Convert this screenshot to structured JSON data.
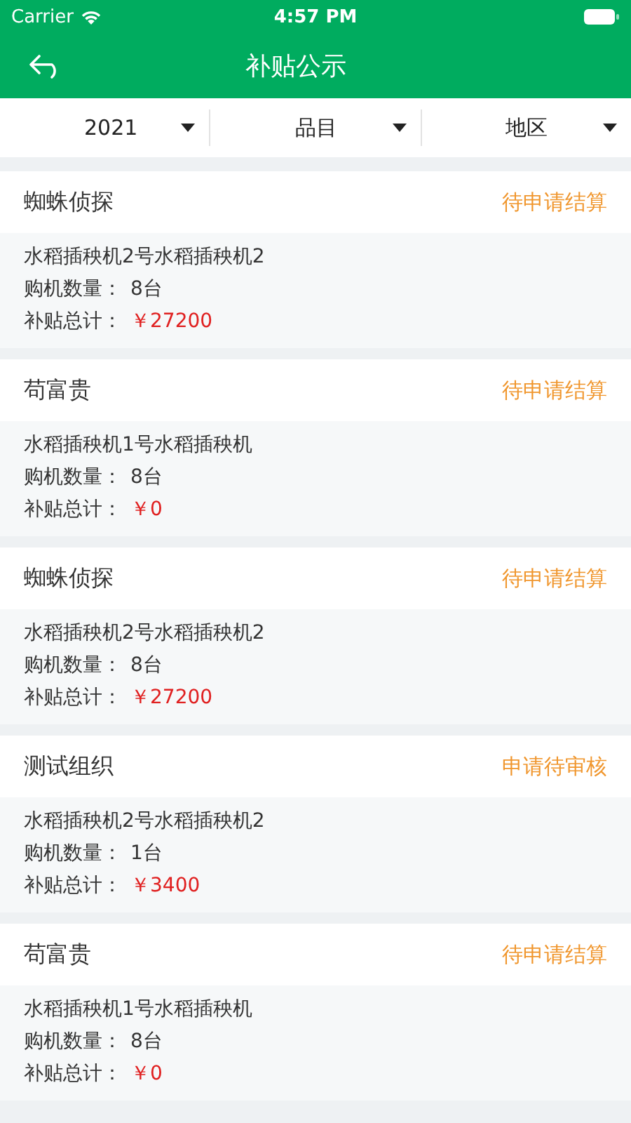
{
  "status_bar": {
    "carrier": "Carrier",
    "time": "4:57 PM"
  },
  "nav": {
    "title": "补贴公示"
  },
  "filters": [
    {
      "label": "2021"
    },
    {
      "label": "品目"
    },
    {
      "label": "地区"
    }
  ],
  "records": [
    {
      "name": "蜘蛛侦探",
      "status": "待申请结算",
      "model": "水稻插秧机2号水稻插秧机2",
      "qty_label": "购机数量：",
      "qty": "8台",
      "total_label": "补贴总计：",
      "total": "￥27200"
    },
    {
      "name": "苟富贵",
      "status": "待申请结算",
      "model": "水稻插秧机1号水稻插秧机",
      "qty_label": "购机数量：",
      "qty": "8台",
      "total_label": "补贴总计：",
      "total": "￥0"
    },
    {
      "name": "蜘蛛侦探",
      "status": "待申请结算",
      "model": "水稻插秧机2号水稻插秧机2",
      "qty_label": "购机数量：",
      "qty": "8台",
      "total_label": "补贴总计：",
      "total": "￥27200"
    },
    {
      "name": "测试组织",
      "status": "申请待审核",
      "model": "水稻插秧机2号水稻插秧机2",
      "qty_label": "购机数量：",
      "qty": "1台",
      "total_label": "补贴总计：",
      "total": "￥3400"
    },
    {
      "name": "苟富贵",
      "status": "待申请结算",
      "model": "水稻插秧机1号水稻插秧机",
      "qty_label": "购机数量：",
      "qty": "8台",
      "total_label": "补贴总计：",
      "total": "￥0"
    }
  ]
}
